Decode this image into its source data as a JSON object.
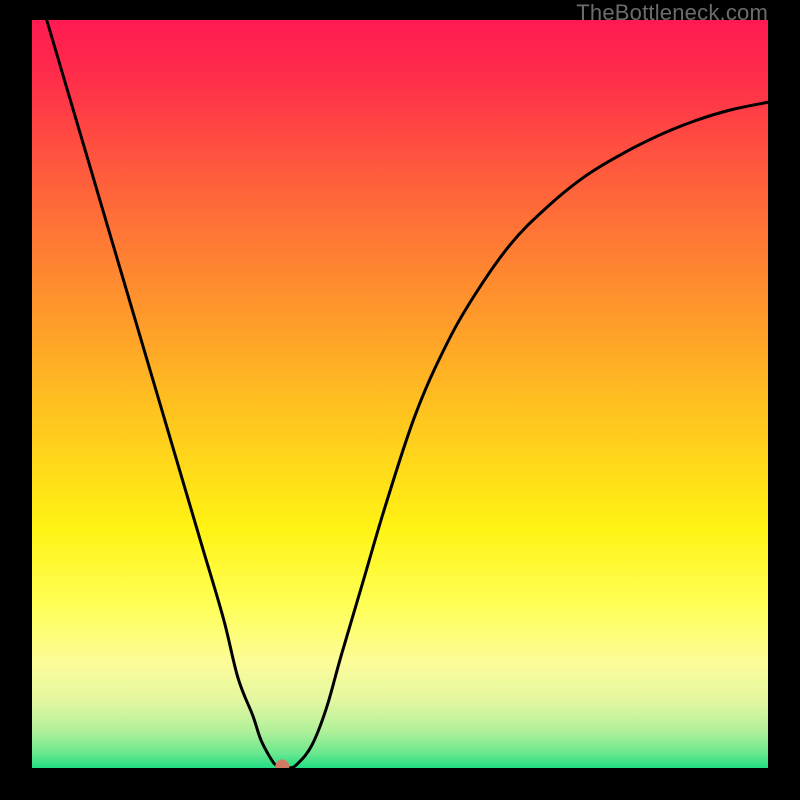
{
  "watermark": "TheBottleneck.com",
  "chart_data": {
    "type": "line",
    "title": "",
    "xlabel": "",
    "ylabel": "",
    "xlim": [
      0,
      100
    ],
    "ylim": [
      0,
      100
    ],
    "series": [
      {
        "name": "curve",
        "x": [
          2,
          5,
          8,
          11,
          14,
          17,
          20,
          23,
          26,
          28,
          30,
          31,
          32,
          33,
          34,
          35,
          36,
          38,
          40,
          42,
          45,
          48,
          52,
          56,
          60,
          65,
          70,
          75,
          80,
          85,
          90,
          95,
          100
        ],
        "y": [
          100,
          90,
          80,
          70,
          60,
          50,
          40,
          30,
          20,
          12,
          7,
          4,
          2,
          0.5,
          0,
          0,
          0.5,
          3,
          8,
          15,
          25,
          35,
          47,
          56,
          63,
          70,
          75,
          79,
          82,
          84.5,
          86.5,
          88,
          89
        ]
      }
    ],
    "marker": {
      "x": 34.0,
      "y": 0.2
    },
    "gradient_stops": [
      {
        "offset": 0.0,
        "color": "#ff1a52"
      },
      {
        "offset": 0.08,
        "color": "#ff2e4a"
      },
      {
        "offset": 0.2,
        "color": "#ff5a3d"
      },
      {
        "offset": 0.35,
        "color": "#ff8b2f"
      },
      {
        "offset": 0.52,
        "color": "#ffc21f"
      },
      {
        "offset": 0.68,
        "color": "#fff314"
      },
      {
        "offset": 0.78,
        "color": "#ffff55"
      },
      {
        "offset": 0.86,
        "color": "#fcfc9a"
      },
      {
        "offset": 0.91,
        "color": "#e3f7a0"
      },
      {
        "offset": 0.95,
        "color": "#b2f09a"
      },
      {
        "offset": 0.98,
        "color": "#6be88f"
      },
      {
        "offset": 1.0,
        "color": "#22dd83"
      }
    ]
  }
}
